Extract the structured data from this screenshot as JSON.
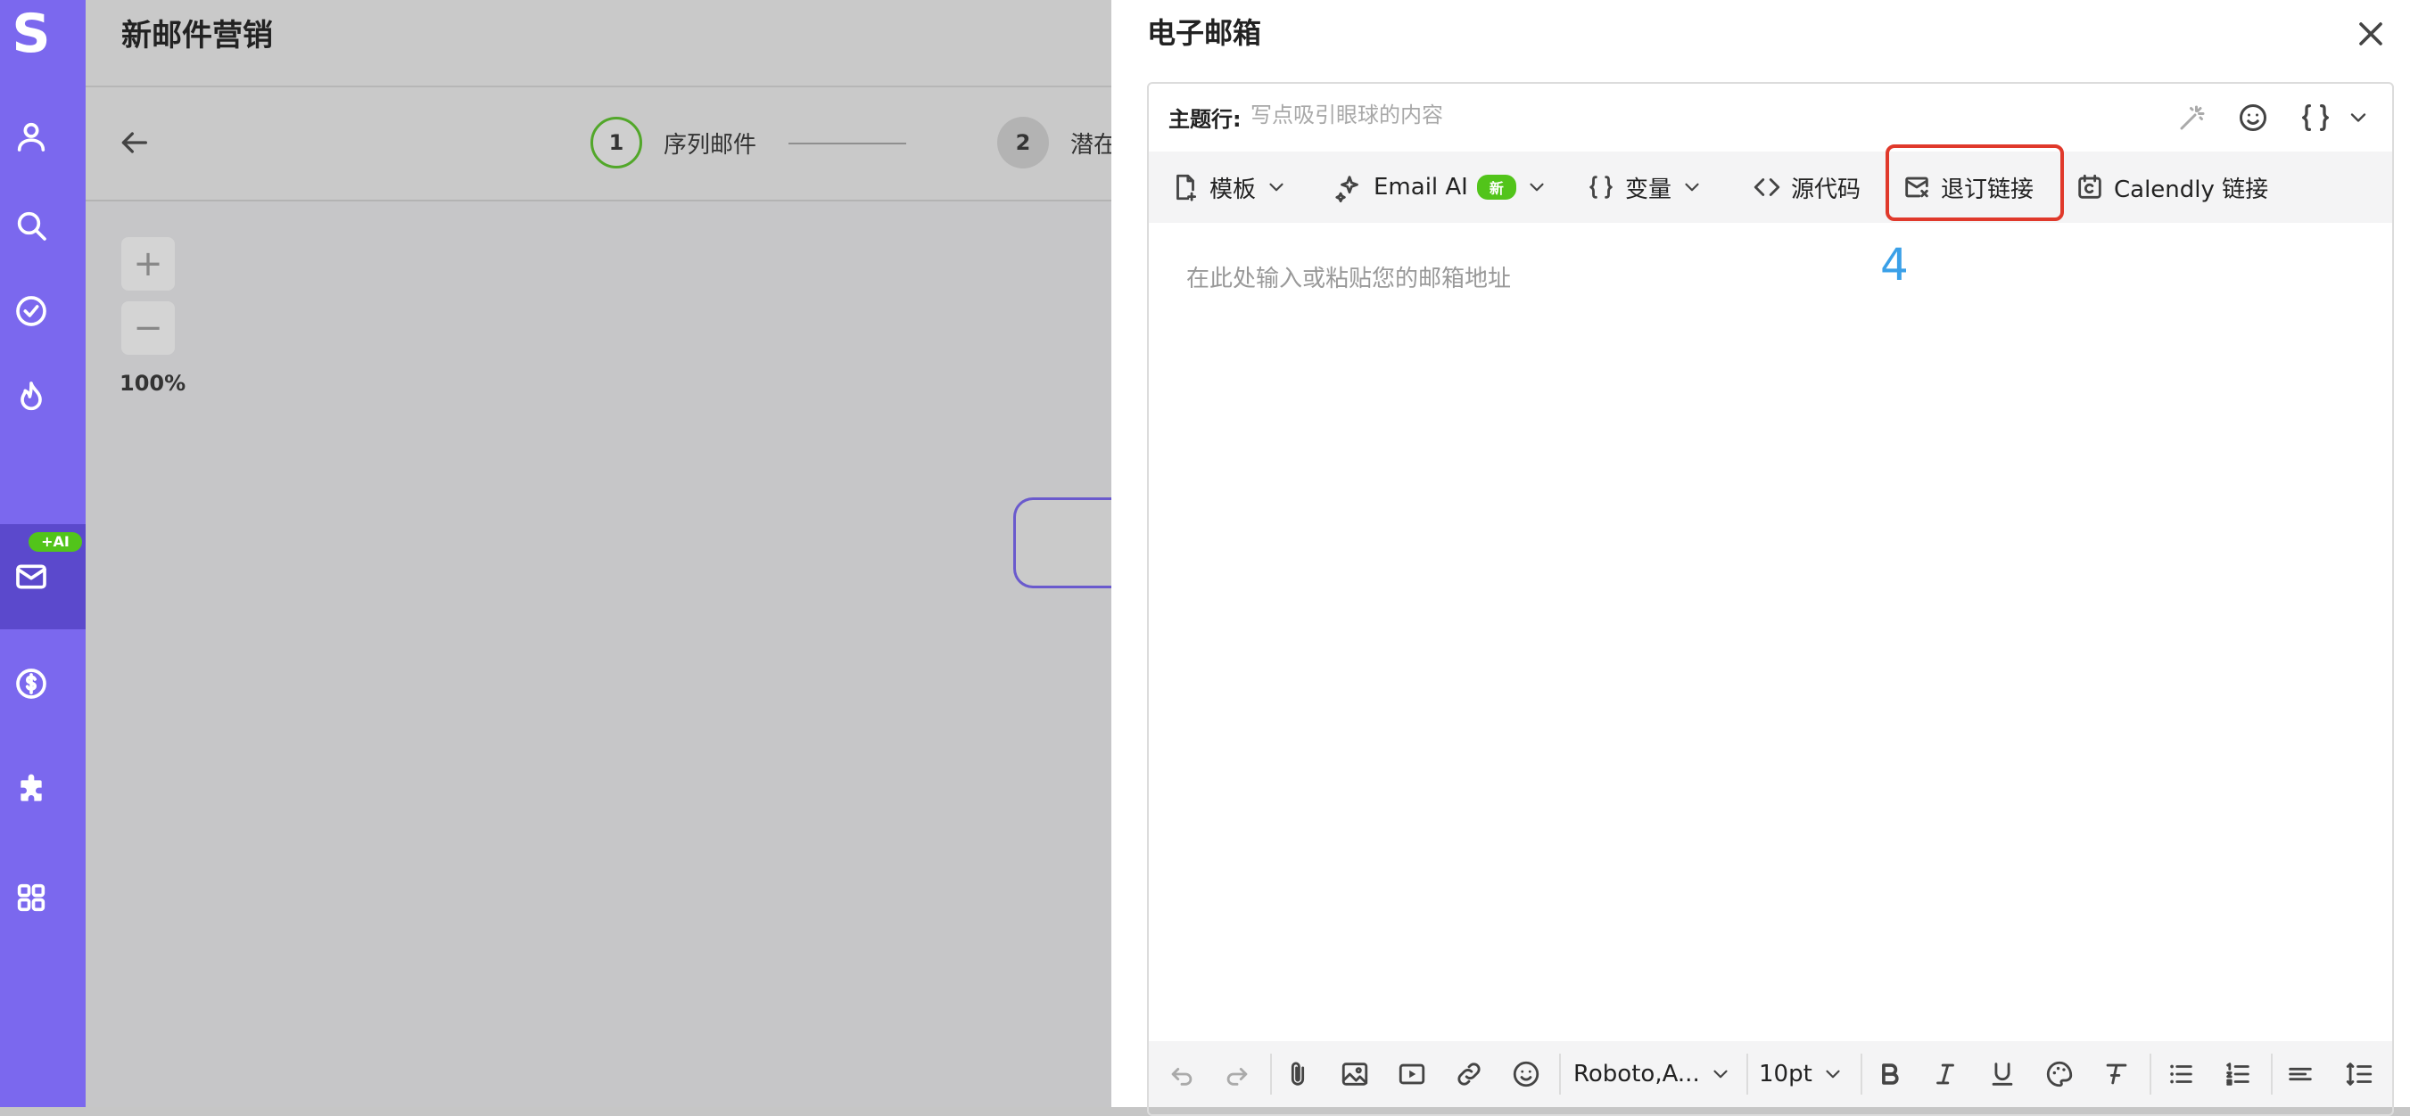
{
  "app": {
    "logo_text": "S",
    "ai_badge": "+AI",
    "accent_color": "#7b68ee",
    "nav_icons": [
      "user-icon",
      "search-icon",
      "check-circle-icon",
      "fire-icon",
      "mail-icon",
      "dollar-icon",
      "puzzle-icon",
      "apps-grid-icon"
    ]
  },
  "main": {
    "title": "新邮件营销",
    "steps": [
      {
        "number": "1",
        "label": "序列邮件"
      },
      {
        "number": "2",
        "label": "潜在"
      }
    ],
    "zoom_level": "100%"
  },
  "panel": {
    "title": "电子邮箱",
    "subject_label": "主题行:",
    "subject_placeholder": "写点吸引眼球的内容",
    "toolbar": {
      "template": "模板",
      "email_ai": "Email AI",
      "email_ai_badge": "新",
      "variables": "变量",
      "source_code": "源代码",
      "unsubscribe_link": "退订链接",
      "calendly_link": "Calendly 链接"
    },
    "annotation_number": "4",
    "body_placeholder": "在此处输入或粘贴您的邮箱地址",
    "bottom_toolbar": {
      "font_family": "Roboto,A...",
      "font_size": "10pt"
    }
  }
}
